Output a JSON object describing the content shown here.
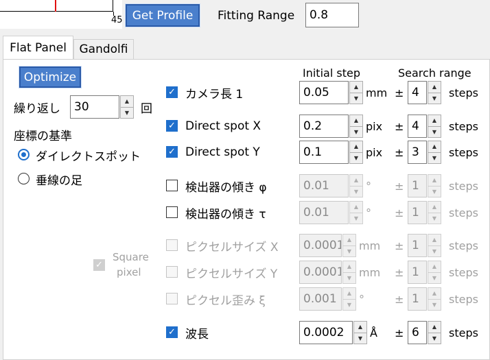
{
  "plot": {
    "tick_label": "45"
  },
  "toolbar": {
    "get_profile_label": "Get Profile",
    "fitting_range_label": "Fitting Range",
    "fitting_range_value": "0.8"
  },
  "tabs": [
    {
      "label": "Flat Panel",
      "active": true
    },
    {
      "label": "Gandolfi",
      "active": false
    }
  ],
  "left": {
    "optimize_label": "Optimize",
    "repeat_label": "繰り返し",
    "repeat_value": "30",
    "repeat_unit": "回",
    "coord_base_label": "座標の基準",
    "radio_direct": "ダイレクトスポット",
    "radio_foot": "垂線の足",
    "square_pixel_line1": "Square",
    "square_pixel_line2": "pixel"
  },
  "headers": {
    "initial_step": "Initial step",
    "search_range": "Search range"
  },
  "params": [
    {
      "label": "カメラ長 1",
      "checked": true,
      "enabled": true,
      "step": "0.05",
      "unit": "mm",
      "pm": "±",
      "range": "4",
      "steps": "steps"
    },
    {
      "label": "Direct spot X",
      "checked": true,
      "enabled": true,
      "step": "0.2",
      "unit": "pix",
      "pm": "±",
      "range": "4",
      "steps": "steps"
    },
    {
      "label": "Direct spot Y",
      "checked": true,
      "enabled": true,
      "step": "0.1",
      "unit": "pix",
      "pm": "±",
      "range": "3",
      "steps": "steps"
    },
    {
      "label": "検出器の傾き φ",
      "checked": false,
      "enabled": true,
      "step": "0.01",
      "unit": "°",
      "pm": "±",
      "range": "1",
      "steps": "steps"
    },
    {
      "label": "検出器の傾き τ",
      "checked": false,
      "enabled": true,
      "step": "0.01",
      "unit": "°",
      "pm": "±",
      "range": "1",
      "steps": "steps"
    },
    {
      "label": "ピクセルサイズ X",
      "checked": false,
      "enabled": false,
      "step": "0.0001",
      "unit": "mm",
      "pm": "±",
      "range": "1",
      "steps": "steps"
    },
    {
      "label": "ピクセルサイズ Y",
      "checked": false,
      "enabled": false,
      "step": "0.0001",
      "unit": "mm",
      "pm": "±",
      "range": "1",
      "steps": "steps"
    },
    {
      "label": "ピクセル歪み ξ",
      "checked": false,
      "enabled": false,
      "step": "0.001",
      "unit": "°",
      "pm": "±",
      "range": "1",
      "steps": "steps"
    },
    {
      "label": "波長",
      "checked": true,
      "enabled": true,
      "step": "0.0002",
      "unit": "Å",
      "pm": "±",
      "range": "6",
      "steps": "steps"
    }
  ],
  "colors": {
    "accent": "#1f6fcc",
    "button_accent": "#4a7fcc",
    "plot_line": "#e01010"
  },
  "icons": {
    "check": "check-icon",
    "spin_up": "chevron-up-icon",
    "spin_down": "chevron-down-icon"
  }
}
